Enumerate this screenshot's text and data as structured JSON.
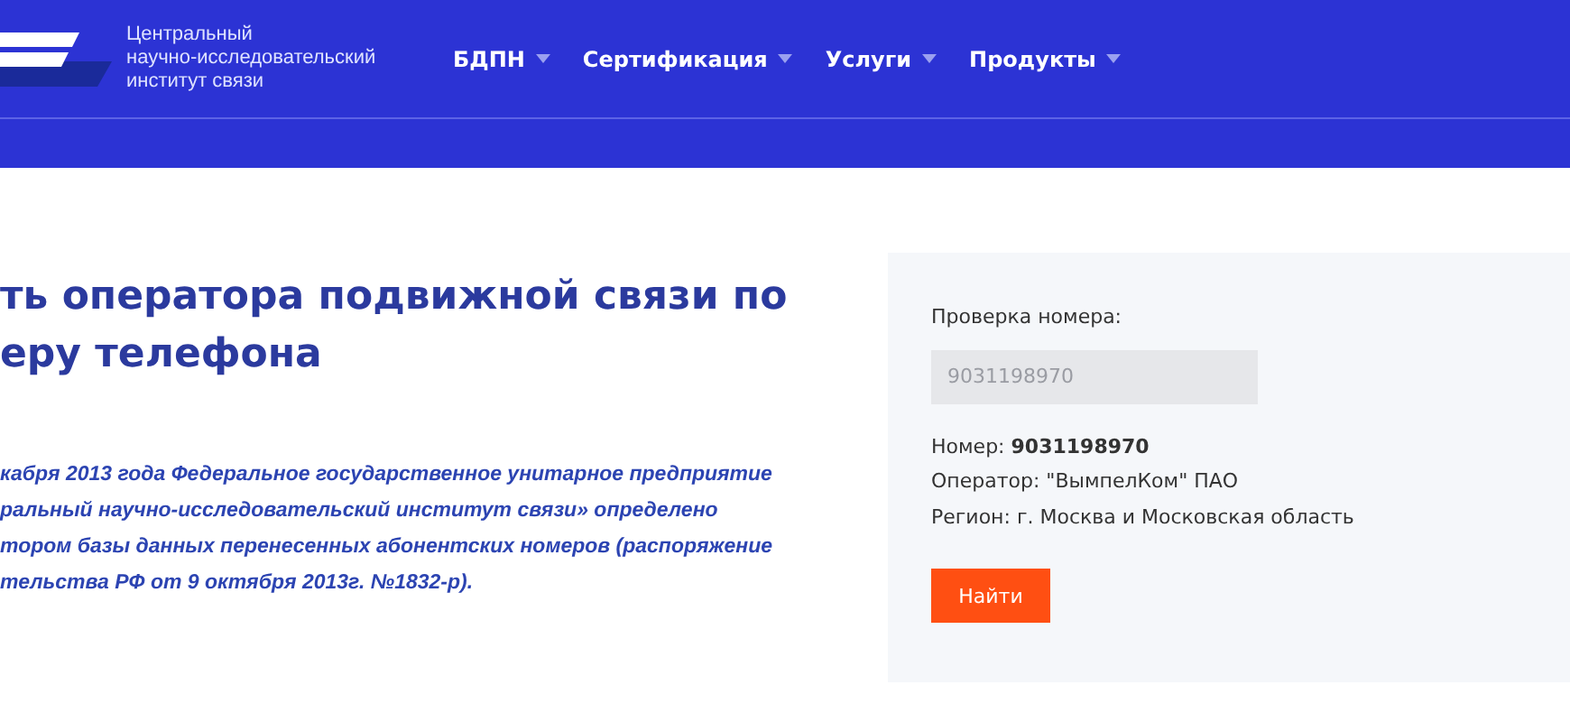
{
  "header": {
    "logo_text": [
      "Центральный",
      "научно-исследовательский",
      "институт связи"
    ],
    "nav": [
      {
        "label": "БДПН"
      },
      {
        "label": "Сертификация"
      },
      {
        "label": "Услуги"
      },
      {
        "label": "Продукты"
      }
    ]
  },
  "main": {
    "heading": [
      "ть оператора подвижной связи по",
      "еру телефона"
    ],
    "paragraph": [
      "кабря 2013 года Федеральное государственное унитарное предприятие",
      "ральный научно-исследовательский институт связи» определено",
      "тором базы данных перенесенных абонентских номеров (распоряжение",
      "тельства РФ от 9 октября 2013г. №1832-р)."
    ]
  },
  "check": {
    "label": "Проверка номера:",
    "input": {
      "placeholder": "9031198970"
    },
    "results": [
      "Номер: **9031198970**",
      "Оператор: \"ВымпелКом\" ПАО",
      "Регион: г. Москва и Московская область"
    ],
    "button": "Найти"
  }
}
